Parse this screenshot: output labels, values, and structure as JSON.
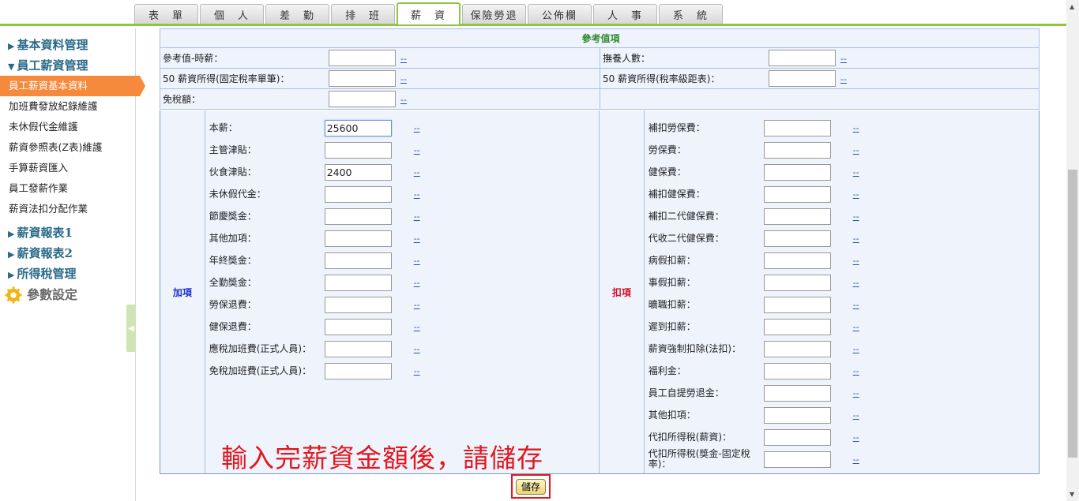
{
  "tabs": [
    {
      "label": "表　單"
    },
    {
      "label": "個　人"
    },
    {
      "label": "差　勤"
    },
    {
      "label": "排　班"
    },
    {
      "label": "薪　資"
    },
    {
      "label": "保險勞退"
    },
    {
      "label": "公佈欄"
    },
    {
      "label": "人　事"
    },
    {
      "label": "系　統"
    }
  ],
  "active_tab": "薪　資",
  "sidebar": {
    "groups": [
      {
        "label": "基本資料管理",
        "arrow": "▶"
      },
      {
        "label": "員工薪資管理",
        "arrow": "▼"
      }
    ],
    "items": [
      {
        "label": "員工薪資基本資料"
      },
      {
        "label": "加班費發放紀錄維護"
      },
      {
        "label": "未休假代金維護"
      },
      {
        "label": "薪資參照表(Z表)維護"
      },
      {
        "label": "手算薪資匯入"
      },
      {
        "label": "員工發薪作業"
      },
      {
        "label": "薪資法扣分配作業"
      }
    ],
    "groups2": [
      {
        "label": "薪資報表1",
        "arrow": "▶"
      },
      {
        "label": "薪資報表2",
        "arrow": "▶"
      },
      {
        "label": "所得稅管理",
        "arrow": "▶"
      }
    ],
    "param_label": "參數設定"
  },
  "reference": {
    "title": "參考值項",
    "rows": [
      {
        "left_label": "參考值-時薪：",
        "right_label": "撫養人數："
      },
      {
        "left_label": "50 薪資所得(固定稅率單筆)：",
        "right_label": "50 薪資所得(稅率級距表)："
      },
      {
        "left_label": "免稅額：",
        "right_label": ""
      }
    ],
    "dash": "--"
  },
  "additions": {
    "section_label": "加項",
    "rows": [
      {
        "label": "本薪：",
        "value": "25600"
      },
      {
        "label": "主管津貼：",
        "value": ""
      },
      {
        "label": "伙食津貼：",
        "value": "2400"
      },
      {
        "label": "未休假代金：",
        "value": ""
      },
      {
        "label": "節慶獎金：",
        "value": ""
      },
      {
        "label": "其他加項：",
        "value": ""
      },
      {
        "label": "年終獎金：",
        "value": ""
      },
      {
        "label": "全勤獎金：",
        "value": ""
      },
      {
        "label": "勞保退費：",
        "value": ""
      },
      {
        "label": "健保退費：",
        "value": ""
      },
      {
        "label": "應稅加班費(正式人員)：",
        "value": ""
      },
      {
        "label": "免稅加班費(正式人員)：",
        "value": ""
      }
    ]
  },
  "deductions": {
    "section_label": "扣項",
    "rows": [
      {
        "label": "補扣勞保費：",
        "value": ""
      },
      {
        "label": "勞保費：",
        "value": ""
      },
      {
        "label": "健保費：",
        "value": ""
      },
      {
        "label": "補扣健保費：",
        "value": ""
      },
      {
        "label": "補扣二代健保費：",
        "value": ""
      },
      {
        "label": "代收二代健保費：",
        "value": ""
      },
      {
        "label": "病假扣薪：",
        "value": ""
      },
      {
        "label": "事假扣薪：",
        "value": ""
      },
      {
        "label": "曠職扣薪：",
        "value": ""
      },
      {
        "label": "遲到扣薪：",
        "value": ""
      },
      {
        "label": "薪資強制扣除(法扣)：",
        "value": ""
      },
      {
        "label": "福利金：",
        "value": ""
      },
      {
        "label": "員工自提勞退金：",
        "value": ""
      },
      {
        "label": "其他扣項：",
        "value": ""
      },
      {
        "label": "代扣所得稅(薪資)：",
        "value": ""
      },
      {
        "label": "代扣所得稅(獎金-固定稅率)：",
        "value": ""
      }
    ]
  },
  "notice": "輸入完薪資金額後，請儲存",
  "save_label": "儲存",
  "colors": {
    "accent_green": "#8dc63f",
    "active_orange": "#f58a3c",
    "notice_red": "#e0181f",
    "add_blue": "#1e2fd0"
  }
}
